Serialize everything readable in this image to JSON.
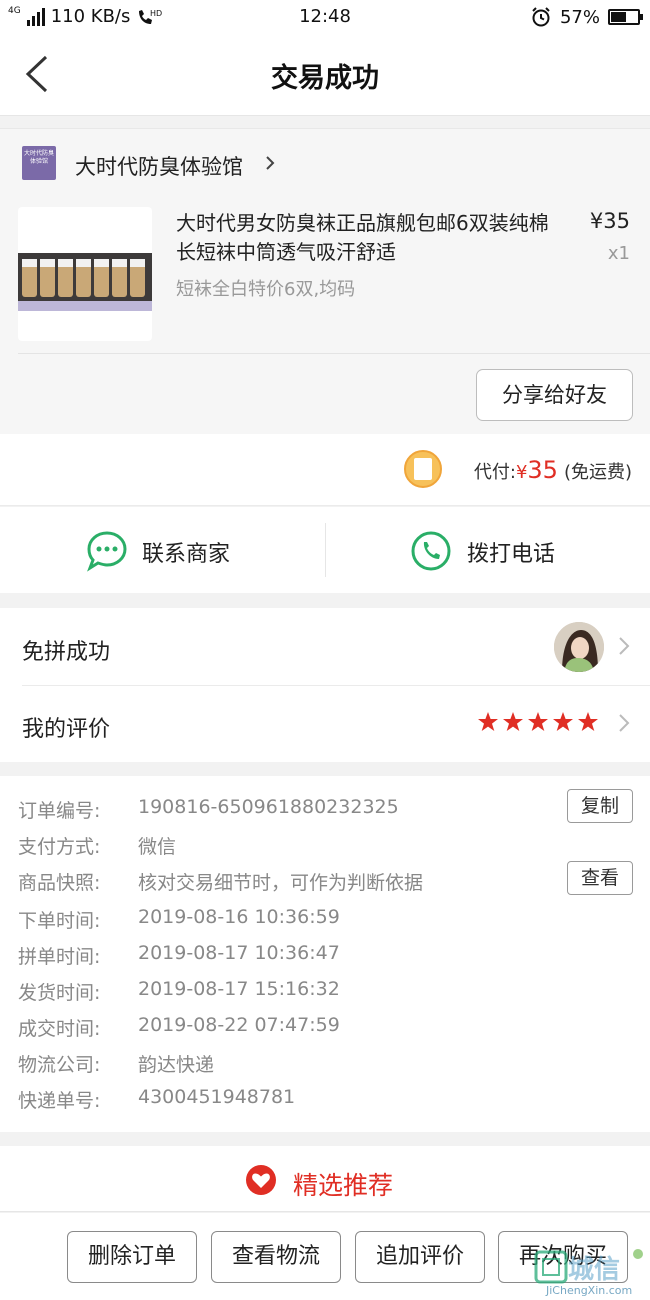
{
  "status_bar": {
    "network": "4G",
    "speed": "110 KB/s",
    "hd": "HD",
    "time": "12:48",
    "battery": "57%",
    "battery_level": 0.57
  },
  "header": {
    "title": "交易成功"
  },
  "shop": {
    "logo_text": "大时代防臭体验馆",
    "name": "大时代防臭体验馆"
  },
  "product": {
    "title": "大时代男女防臭袜正品旗舰包邮6双装纯棉长短袜中筒透气吸汗舒适",
    "spec": "短袜全白特价6双,均码",
    "price": "¥35",
    "quantity": "x1"
  },
  "share_button": "分享给好友",
  "payment": {
    "label": "代付:",
    "currency": "¥",
    "amount": "35",
    "shipping": "(免运费)"
  },
  "contact": {
    "merchant_label": "联系商家",
    "phone_label": "拨打电话"
  },
  "status_rows": {
    "group_label": "免拼成功",
    "review_label": "我的评价",
    "rating": 5
  },
  "order_info": {
    "rows": [
      {
        "key": "订单编号:",
        "value": "190816-650961880232325"
      },
      {
        "key": "支付方式:",
        "value": "微信"
      },
      {
        "key": "商品快照:",
        "value": "核对交易细节时，可作为判断依据"
      },
      {
        "key": "下单时间:",
        "value": "2019-08-16 10:36:59"
      },
      {
        "key": "拼单时间:",
        "value": "2019-08-17 10:36:47"
      },
      {
        "key": "发货时间:",
        "value": "2019-08-17 15:16:32"
      },
      {
        "key": "成交时间:",
        "value": "2019-08-22 07:47:59"
      },
      {
        "key": "物流公司:",
        "value": "韵达快递"
      },
      {
        "key": "快递单号:",
        "value": "4300451948781"
      }
    ],
    "copy_button": "复制",
    "view_button": "查看"
  },
  "recommend": {
    "label": "精选推荐"
  },
  "bottom_bar": {
    "delete": "删除订单",
    "logistics": "查看物流",
    "add_review": "追加评价",
    "rebuy": "再次购买"
  },
  "watermark": {
    "text": "城信",
    "sub": "JiChengXin.com"
  },
  "colors": {
    "accent": "#e02e24",
    "wechat_green": "#2aae67",
    "background": "#f2f2f2"
  }
}
